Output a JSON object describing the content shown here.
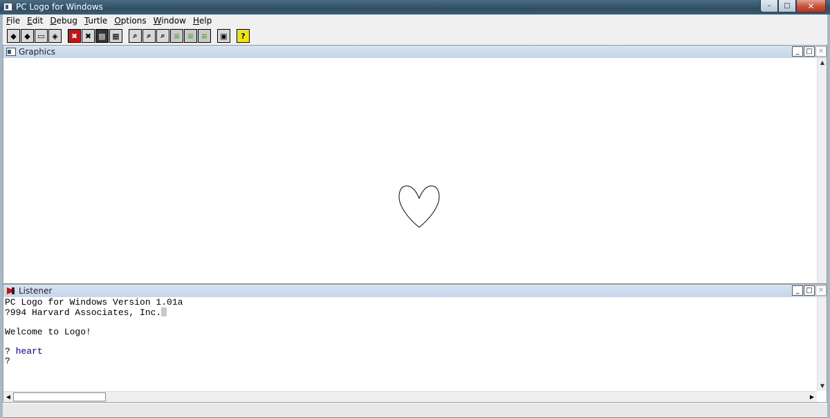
{
  "window": {
    "title": "PC Logo for Windows",
    "buttons": {
      "minimize": "–",
      "maximize": "□",
      "close": "✕"
    }
  },
  "menu": [
    {
      "label_rest": "ile",
      "mnemonic": "F"
    },
    {
      "label_rest": "dit",
      "mnemonic": "E"
    },
    {
      "label_rest": "ebug",
      "mnemonic": "D"
    },
    {
      "label_rest": "urtle",
      "mnemonic": "T"
    },
    {
      "label_rest": "ptions",
      "mnemonic": "O"
    },
    {
      "label_rest": "indow",
      "mnemonic": "W"
    },
    {
      "label_rest": "elp",
      "mnemonic": "H"
    }
  ],
  "toolbar": {
    "glyphs": [
      "◆",
      "◆",
      "▭",
      "◈",
      "✖",
      "✖",
      "▩",
      "▦",
      "⌕",
      "⌕",
      "⌕",
      "≡",
      "≡",
      "≡",
      "▣",
      "?"
    ]
  },
  "graphics": {
    "title": "Graphics",
    "btn_min": "_",
    "btn_max": "□",
    "btn_close": "✕"
  },
  "listener": {
    "title": "Listener",
    "line1": "PC Logo for Windows Version 1.01a",
    "line2": "?994 Harvard Associates, Inc.",
    "line3": "",
    "line4": "Welcome to Logo!",
    "line5": "",
    "prompt1": "? ",
    "command": "heart",
    "prompt2": "?",
    "btn_min": "_",
    "btn_max": "□",
    "btn_close": "✕"
  },
  "colors": {
    "command_text": "#0000cc",
    "child_titlebar": "#c5d7ea"
  }
}
